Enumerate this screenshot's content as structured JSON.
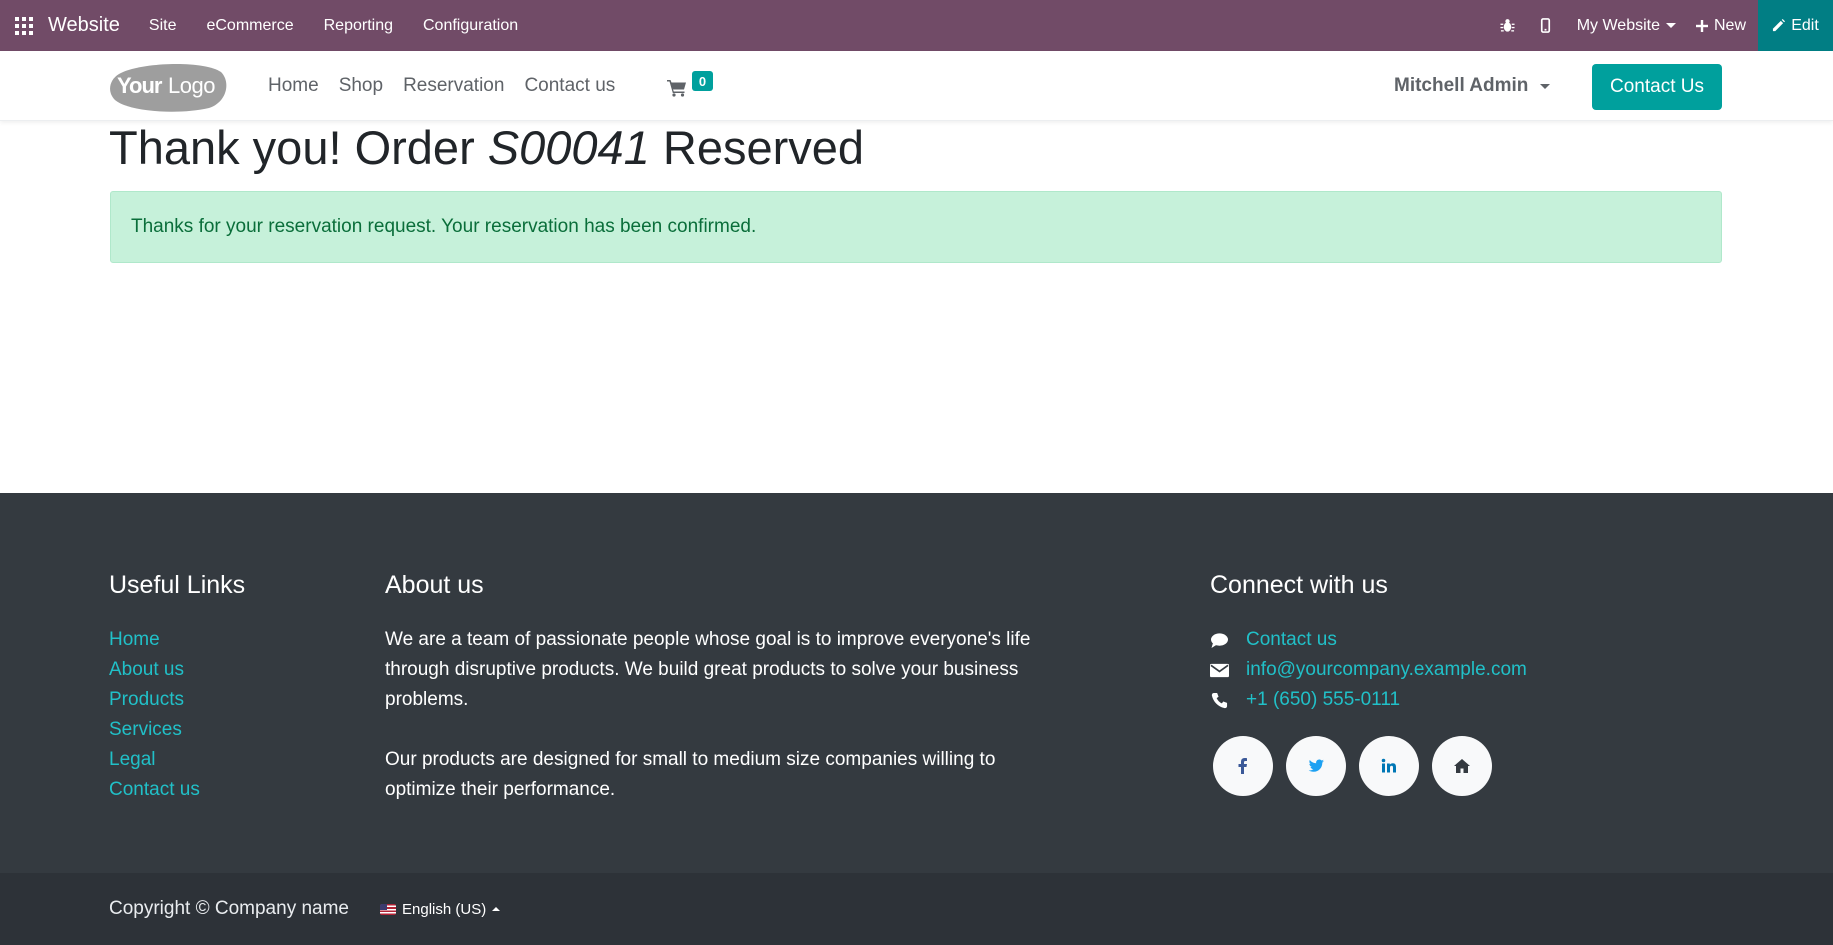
{
  "adminbar": {
    "brand": "Website",
    "menu": [
      "Site",
      "eCommerce",
      "Reporting",
      "Configuration"
    ],
    "website_selector": "My Website",
    "new_label": "New",
    "edit_label": "Edit"
  },
  "header": {
    "logo_alt": "YourLogo",
    "nav": [
      "Home",
      "Shop",
      "Reservation",
      "Contact us"
    ],
    "cart_count": "0",
    "user": "Mitchell Admin",
    "cta": "Contact Us"
  },
  "main": {
    "heading_prefix": "Thank you! Order ",
    "order_id": "S00041",
    "heading_suffix": " Reserved",
    "alert": "Thanks for your reservation request. Your reservation has been confirmed."
  },
  "footer": {
    "useful_links_title": "Useful Links",
    "useful_links": [
      "Home",
      "About us",
      "Products",
      "Services",
      "Legal",
      "Contact us"
    ],
    "about_title": "About us",
    "about_p1": "We are a team of passionate people whose goal is to improve everyone's life through disruptive products. We build great products to solve your business problems.",
    "about_p2": "Our products are designed for small to medium size companies willing to optimize their performance.",
    "connect_title": "Connect with us",
    "connect_contact": "Contact us",
    "connect_email": "info@yourcompany.example.com",
    "connect_phone": "+1 (650) 555-0111",
    "socials": [
      "facebook-icon",
      "twitter-icon",
      "linkedin-icon",
      "home-icon"
    ],
    "copyright": "Copyright © Company name",
    "language": "English (US)"
  },
  "colors": {
    "admin_bar": "#714B67",
    "edit_button": "#017E84",
    "primary": "#00A09D",
    "link": "#21c0c8",
    "footer": "#343a40",
    "copy_bar": "#2d3238",
    "alert_bg": "#c6f1da",
    "alert_text": "#0a6e3a"
  }
}
